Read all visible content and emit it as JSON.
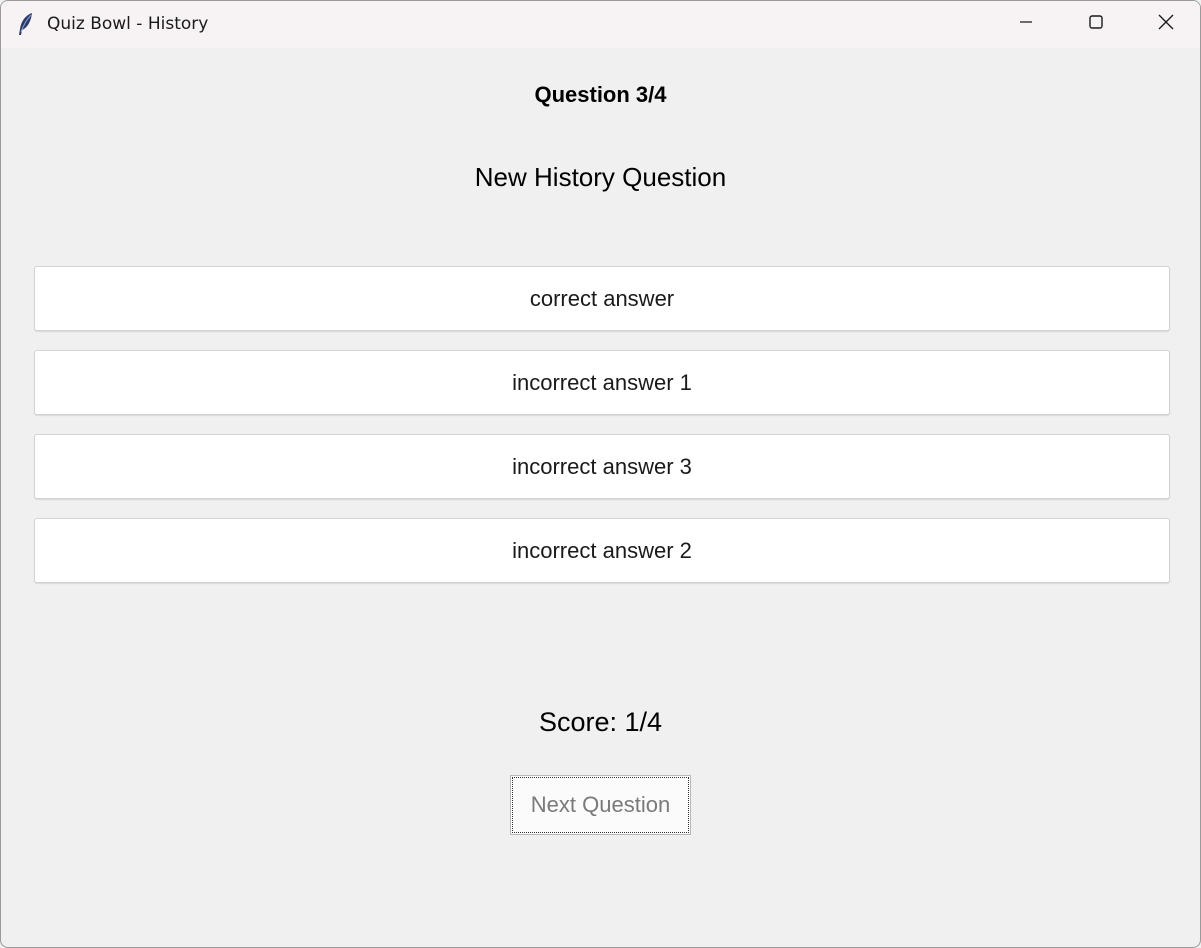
{
  "window": {
    "title": "Quiz Bowl - History",
    "app_icon": "feather-icon",
    "controls": {
      "minimize": "minimize-icon",
      "maximize": "maximize-icon",
      "close": "close-icon"
    }
  },
  "quiz": {
    "question_number": "Question 3/4",
    "question_text": "New History Question",
    "answers": [
      "correct answer",
      "incorrect answer 1",
      "incorrect answer 3",
      "incorrect answer 2"
    ],
    "score": "Score: 1/4",
    "next_button_label": "Next Question",
    "next_button_enabled": false
  },
  "colors": {
    "window_bg": "#f0f0f0",
    "titlebar_bg": "#f7f2f4",
    "answer_bg": "#ffffff",
    "disabled_text": "#7a7a7a"
  }
}
